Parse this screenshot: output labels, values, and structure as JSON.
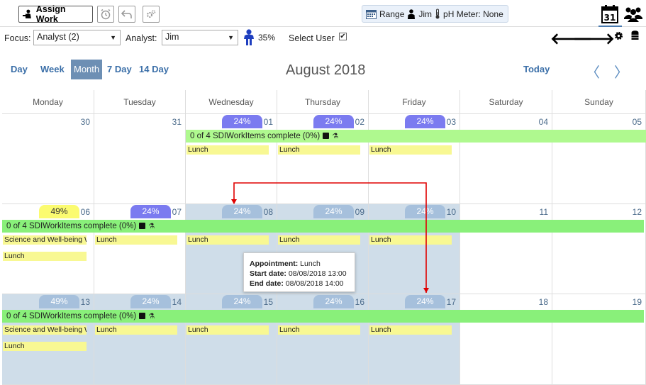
{
  "toolbar": {
    "assign_work_label": "Assign Work",
    "range_label": "Range",
    "range_user": "Jim",
    "ph_meter_label": "pH Meter: None"
  },
  "filters": {
    "focus_label": "Focus:",
    "focus_value": "Analyst (2)",
    "analyst_label": "Analyst:",
    "analyst_value": "Jim",
    "user_percent": "35%",
    "select_user_label": "Select User"
  },
  "views": {
    "day": "Day",
    "week": "Week",
    "month": "Month",
    "seven_day": "7 Day",
    "fourteen_day": "14 Day",
    "today": "Today",
    "title": "August 2018"
  },
  "weekdays": [
    "Monday",
    "Tuesday",
    "Wednesday",
    "Thursday",
    "Friday",
    "Saturday",
    "Sunday"
  ],
  "weeks": [
    {
      "days": [
        "30",
        "31",
        "01",
        "02",
        "03",
        "04",
        "05"
      ],
      "workload": [
        "",
        "",
        "24%",
        "24%",
        "24%",
        "",
        ""
      ],
      "workitems": "0 of 4 SDIWorkItems complete (0%)",
      "events": [
        [],
        [],
        [
          "Lunch"
        ],
        [
          "Lunch"
        ],
        [
          "Lunch"
        ],
        [],
        []
      ]
    },
    {
      "days": [
        "06",
        "07",
        "08",
        "09",
        "10",
        "11",
        "12"
      ],
      "workload": [
        "49%",
        "24%",
        "24%",
        "24%",
        "24%",
        "",
        ""
      ],
      "workitems": "0 of 4 SDIWorkItems complete (0%)",
      "events": [
        [
          "Science and Well-being W",
          "Lunch"
        ],
        [
          "Lunch"
        ],
        [
          "Lunch"
        ],
        [
          "Lunch"
        ],
        [
          "Lunch"
        ],
        [],
        []
      ]
    },
    {
      "days": [
        "13",
        "14",
        "15",
        "16",
        "17",
        "18",
        "19"
      ],
      "workload": [
        "49%",
        "24%",
        "24%",
        "24%",
        "24%",
        "",
        ""
      ],
      "workitems": "0 of 4 SDIWorkItems complete (0%)",
      "events": [
        [
          "Science and Well-being W",
          "Lunch"
        ],
        [
          "Lunch"
        ],
        [
          "Lunch"
        ],
        [
          "Lunch"
        ],
        [
          "Lunch"
        ],
        [],
        []
      ]
    }
  ],
  "tooltip": {
    "appointment_label": "Appointment:",
    "appointment_value": "Lunch",
    "start_label": "Start date:",
    "start_value": "08/08/2018 13:00",
    "end_label": "End date:",
    "end_value": "08/08/2018 14:00"
  },
  "colors": {
    "accent": "#3b6fa8",
    "past_cell": "#cfdde9",
    "workload_dark": "#7b7bf0",
    "workload_light": "#a6c0dc",
    "workload_high": "#fbfb70",
    "workitems_bar": "#aff98f",
    "event": "#f8f893",
    "annotation_arrow": "#e00000"
  }
}
